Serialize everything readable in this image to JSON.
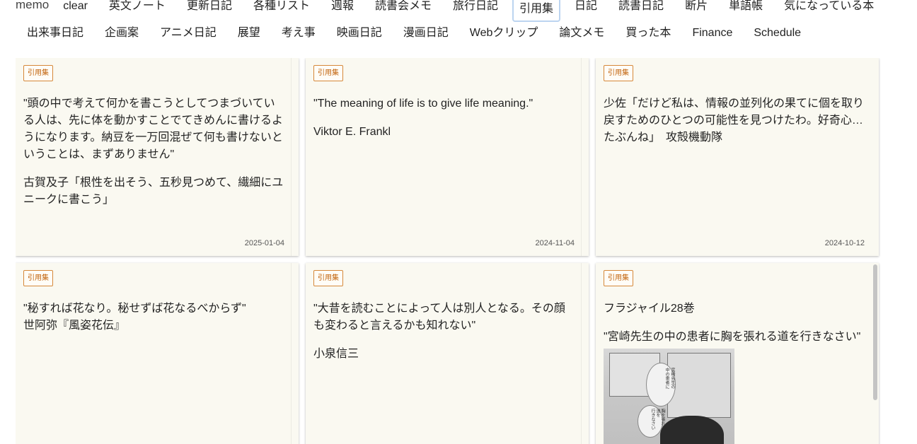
{
  "nav": {
    "brand": "memo",
    "row1": [
      "clear",
      "英文ノート",
      "更新日記",
      "各種リスト",
      "週報",
      "読書会メモ",
      "旅行日記",
      "引用集",
      "日記",
      "読書日記",
      "断片",
      "単語帳",
      "気になっている本"
    ],
    "row2": [
      "出来事日記",
      "企画案",
      "アニメ日記",
      "展望",
      "考え事",
      "映画日記",
      "漫画日記",
      "Webクリップ",
      "論文メモ",
      "買った本",
      "Finance",
      "Schedule"
    ],
    "active": "引用集"
  },
  "cards": [
    {
      "tag": "引用集",
      "paragraphs": [
        "\"頭の中で考えて何かを書こうとしてつまづいている人は、先に体を動かすことでてきめんに書けるようになります。納豆を一万回混ぜて何も書けないということは、まずありません\"",
        "古賀及子「根性を出そう、五秒見つめて、繊細にユニークに書こう」"
      ],
      "date": "2025-01-04"
    },
    {
      "tag": "引用集",
      "paragraphs": [
        "\"The meaning of life is to give life meaning.\"",
        "Viktor E. Frankl"
      ],
      "date": "2024-11-04"
    },
    {
      "tag": "引用集",
      "paragraphs": [
        "少佐「だけど私は、情報の並列化の果てに個を取り戻すためのひとつの可能性を見つけたわ。好奇心…たぶんね」　攻殻機動隊"
      ],
      "date": "2024-10-12"
    },
    {
      "tag": "引用集",
      "lines": [
        "\"秘すれば花なり。秘せずば花なるべからず\"",
        "世阿弥『風姿花伝』"
      ]
    },
    {
      "tag": "引用集",
      "paragraphs": [
        "\"大昔を読むことによって人は別人となる。その顔も変わると言えるかも知れない\"",
        "小泉信三"
      ]
    },
    {
      "tag": "引用集",
      "paragraphs": [
        "フラジャイル28巻",
        "\"宮崎先生の中の患者に胸を張れる道を行きなさい\""
      ],
      "image_text": [
        "宮崎先生の",
        "中の患者に",
        "胸を張れる",
        "道を",
        "行きなさい"
      ]
    }
  ]
}
